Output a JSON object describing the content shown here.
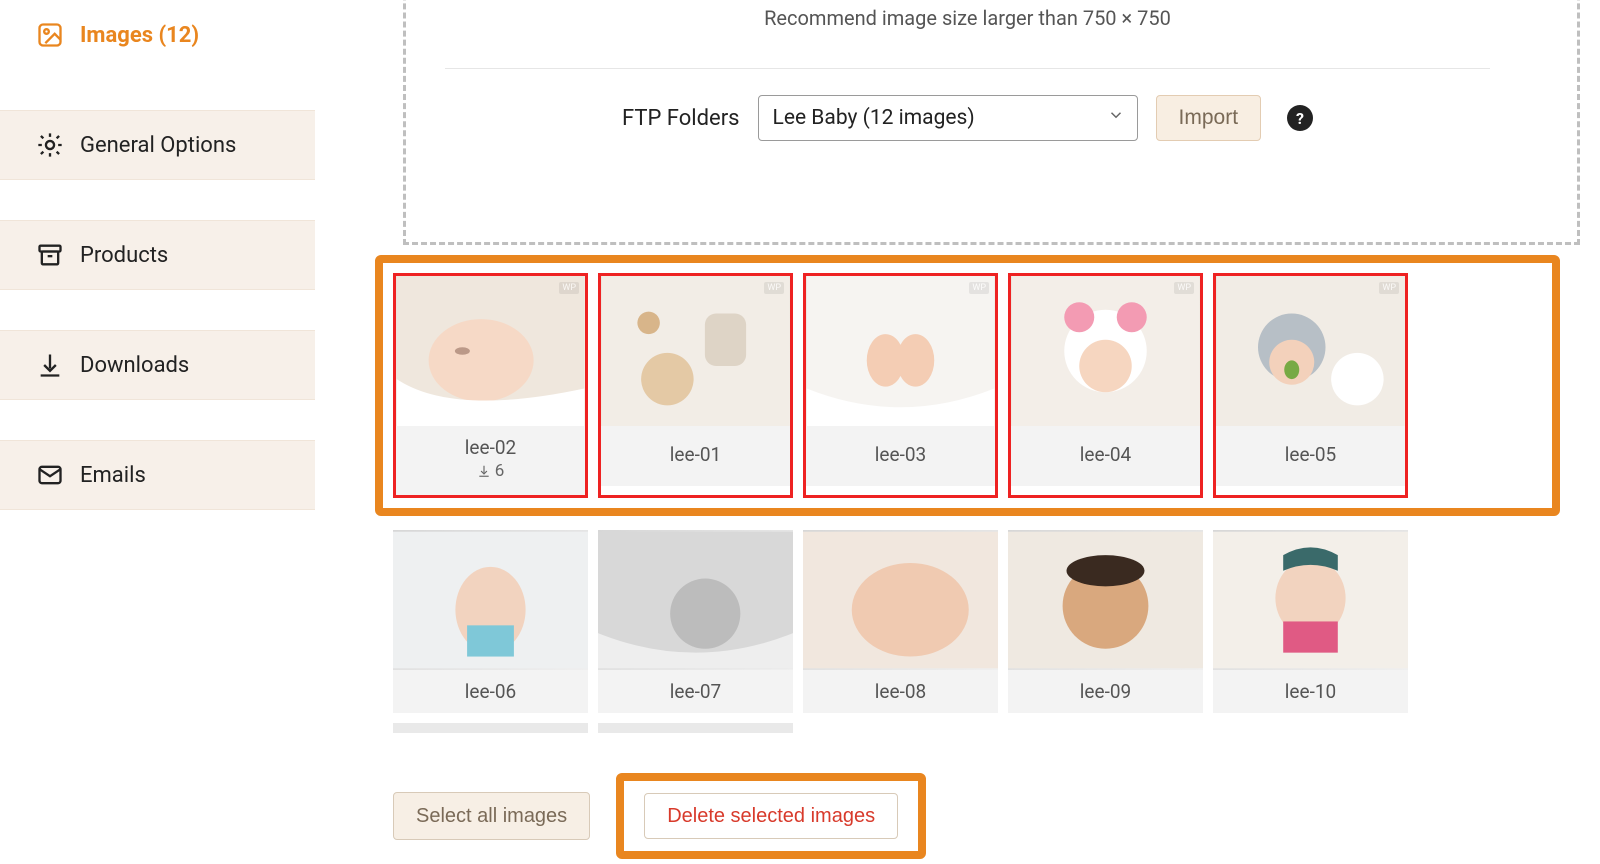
{
  "sidebar": {
    "items": [
      {
        "label": "Images (12)",
        "icon": "image-icon",
        "active": true
      },
      {
        "label": "General Options",
        "icon": "gear-icon",
        "active": false
      },
      {
        "label": "Products",
        "icon": "archive-icon",
        "active": false
      },
      {
        "label": "Downloads",
        "icon": "download-icon",
        "active": false
      },
      {
        "label": "Emails",
        "icon": "mail-icon",
        "active": false
      }
    ]
  },
  "upload": {
    "recommend_text": "Recommend image size larger than 750 × 750",
    "ftp_label": "FTP Folders",
    "ftp_selected": "Lee Baby (12 images)",
    "import_label": "Import"
  },
  "gallery": {
    "selected_row": [
      {
        "name": "lee-02",
        "downloads": 6
      },
      {
        "name": "lee-01"
      },
      {
        "name": "lee-03"
      },
      {
        "name": "lee-04"
      },
      {
        "name": "lee-05"
      }
    ],
    "row2": [
      {
        "name": "lee-06"
      },
      {
        "name": "lee-07"
      },
      {
        "name": "lee-08"
      },
      {
        "name": "lee-09"
      },
      {
        "name": "lee-10"
      }
    ]
  },
  "actions": {
    "select_all_label": "Select all images",
    "delete_selected_label": "Delete selected images"
  },
  "watermark": "WP"
}
